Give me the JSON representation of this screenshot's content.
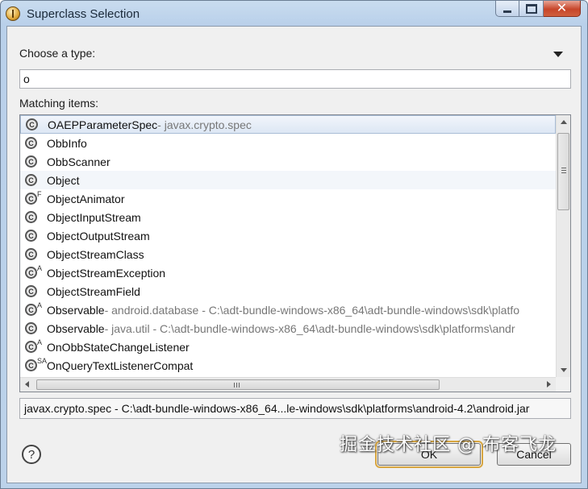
{
  "window": {
    "title": "Superclass Selection"
  },
  "filter": {
    "label": "Choose a type:",
    "value": "o",
    "placeholder": ""
  },
  "list": {
    "label": "Matching items:",
    "items": [
      {
        "modifier": "",
        "name": "OAEPParameterSpec",
        "desc": " - javax.crypto.spec",
        "selected": true
      },
      {
        "modifier": "",
        "name": "ObbInfo",
        "desc": ""
      },
      {
        "modifier": "",
        "name": "ObbScanner",
        "desc": ""
      },
      {
        "modifier": "",
        "name": "Object",
        "desc": ""
      },
      {
        "modifier": "F",
        "name": "ObjectAnimator",
        "desc": ""
      },
      {
        "modifier": "",
        "name": "ObjectInputStream",
        "desc": ""
      },
      {
        "modifier": "",
        "name": "ObjectOutputStream",
        "desc": ""
      },
      {
        "modifier": "",
        "name": "ObjectStreamClass",
        "desc": ""
      },
      {
        "modifier": "A",
        "name": "ObjectStreamException",
        "desc": ""
      },
      {
        "modifier": "",
        "name": "ObjectStreamField",
        "desc": ""
      },
      {
        "modifier": "A",
        "name": "Observable",
        "desc": " - android.database - C:\\adt-bundle-windows-x86_64\\adt-bundle-windows\\sdk\\platfo"
      },
      {
        "modifier": "",
        "name": "Observable",
        "desc": " - java.util - C:\\adt-bundle-windows-x86_64\\adt-bundle-windows\\sdk\\platforms\\andr"
      },
      {
        "modifier": "A",
        "name": "OnObbStateChangeListener",
        "desc": ""
      },
      {
        "modifier": "SA",
        "name": "OnQueryTextListenerCompat",
        "desc": ""
      }
    ]
  },
  "status_text": "javax.crypto.spec - C:\\adt-bundle-windows-x86_64...le-windows\\sdk\\platforms\\android-4.2\\android.jar",
  "buttons": {
    "ok": "OK",
    "cancel": "Cancel",
    "help": "?"
  },
  "watermark": "掘金技术社区 @ 布客飞龙",
  "icons": {
    "class_icon": "class-icon",
    "help_icon": "help-icon"
  }
}
